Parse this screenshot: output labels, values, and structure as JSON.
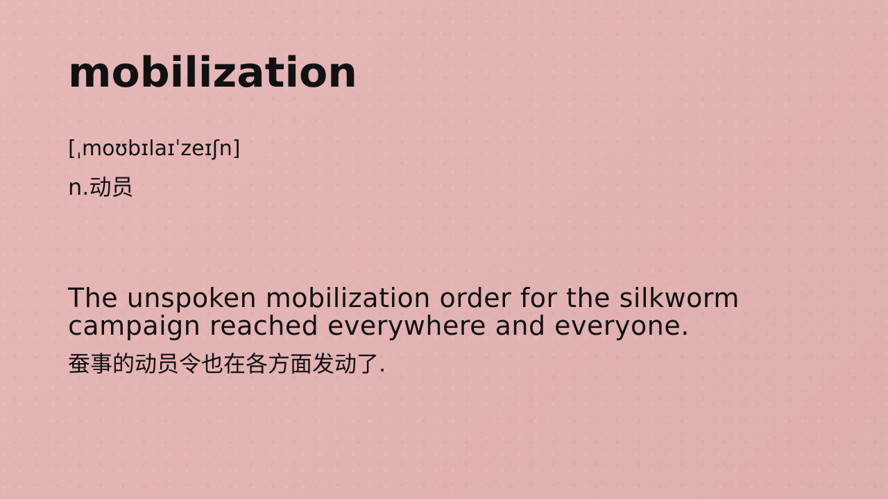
{
  "entry": {
    "word": "mobilization",
    "phonetic": "[ˌmoʊbɪlaɪˈzeɪʃn]",
    "part_of_speech_definition": "n.动员"
  },
  "example": {
    "english": "The unspoken mobilization order for the silkworm campaign reached everywhere and everyone.",
    "chinese": "蚕事的动员令也在各方面发动了."
  }
}
